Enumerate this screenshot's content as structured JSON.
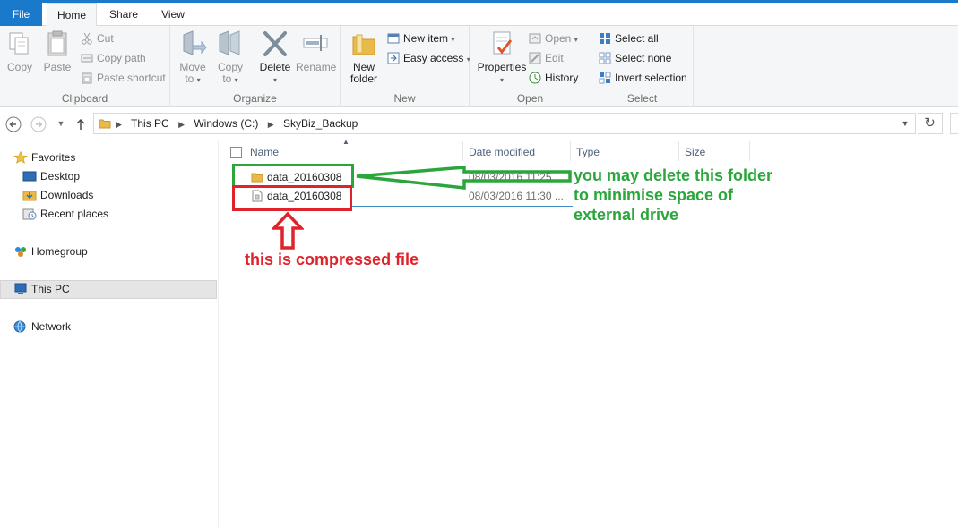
{
  "tabs": {
    "file": "File",
    "home": "Home",
    "share": "Share",
    "view": "View"
  },
  "ribbon": {
    "clipboard": {
      "group_label": "Clipboard",
      "copy": "Copy",
      "paste": "Paste",
      "cut": "Cut",
      "copy_path": "Copy path",
      "paste_shortcut": "Paste shortcut"
    },
    "organize": {
      "group_label": "Organize",
      "move_to_line1": "Move",
      "move_to_line2": "to",
      "copy_to_line1": "Copy",
      "copy_to_line2": "to",
      "delete": "Delete",
      "rename": "Rename"
    },
    "new": {
      "group_label": "New",
      "new_folder_line1": "New",
      "new_folder_line2": "folder",
      "new_item": "New item",
      "easy_access": "Easy access"
    },
    "open": {
      "group_label": "Open",
      "properties": "Properties",
      "open": "Open",
      "edit": "Edit",
      "history": "History"
    },
    "select": {
      "group_label": "Select",
      "select_all": "Select all",
      "select_none": "Select none",
      "invert_selection": "Invert selection"
    }
  },
  "address": {
    "crumbs": [
      "This PC",
      "Windows (C:)",
      "SkyBiz_Backup"
    ]
  },
  "navpane": {
    "favorites": "Favorites",
    "desktop": "Desktop",
    "downloads": "Downloads",
    "recent_places": "Recent places",
    "homegroup": "Homegroup",
    "this_pc": "This PC",
    "network": "Network"
  },
  "filelist": {
    "columns": {
      "name": "Name",
      "date_modified": "Date modified",
      "type": "Type",
      "size": "Size"
    },
    "rows": [
      {
        "name": "data_20160308",
        "date": "08/03/2016 11:25 ...",
        "icon": "folder-icon"
      },
      {
        "name": "data_20160308",
        "date": "08/03/2016 11:30 ...",
        "icon": "compressed-file-icon"
      }
    ]
  },
  "annotations": {
    "green_note_line1": "you may delete this folder",
    "green_note_line2": "to minimise space of",
    "green_note_line3": "external drive",
    "red_note": "this is compressed file",
    "colors": {
      "green": "#2aa63b",
      "red": "#e0222a"
    }
  }
}
